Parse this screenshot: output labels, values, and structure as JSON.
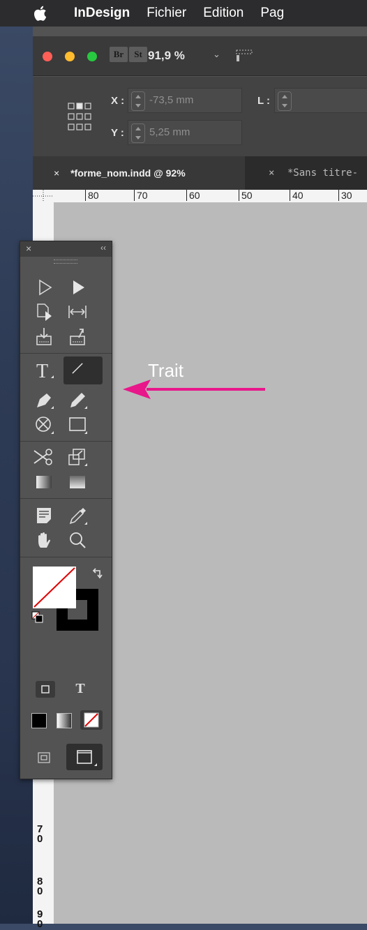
{
  "menubar": {
    "app_name": "InDesign",
    "items": [
      "Fichier",
      "Edition",
      "Pag"
    ]
  },
  "window": {
    "traffic_lights": {
      "close": "#ff5f57",
      "minimize": "#febc2e",
      "zoom": "#28c840"
    },
    "bridge_button": "Br",
    "stock_button": "St",
    "zoom_level": "91,9 %"
  },
  "control_panel": {
    "x_label": "X :",
    "x_value": "-73,5 mm",
    "y_label": "Y :",
    "y_value": "5,25 mm",
    "l_label": "L :"
  },
  "tabs": [
    {
      "close": "×",
      "label": "*forme_nom.indd @ 92%"
    },
    {
      "close": "×",
      "label": "*Sans titre-"
    }
  ],
  "ruler": {
    "horizontal_labels": [
      "80",
      "70",
      "60",
      "50",
      "40",
      "30"
    ],
    "vertical_labels": [
      "7\n0",
      "8\n0",
      "9\n0"
    ]
  },
  "tools_panel": {
    "close_label": "×",
    "collapse_label": "‹‹",
    "selected_tool": "line-tool",
    "tools": [
      "selection-tool-icon",
      "direct-selection-tool-icon",
      "page-tool-icon",
      "gap-tool-icon",
      "content-collector-icon",
      "content-placer-icon",
      "type-tool-icon",
      "line-tool-icon",
      "pen-tool-icon",
      "pencil-tool-icon",
      "rectangle-frame-tool-icon",
      "rectangle-tool-icon",
      "scissors-tool-icon",
      "free-transform-tool-icon",
      "gradient-swatch-tool-icon",
      "gradient-feather-tool-icon",
      "note-tool-icon",
      "eyedropper-tool-icon",
      "hand-tool-icon",
      "zoom-tool-icon"
    ],
    "text_toggle_label": "T"
  },
  "annotation": {
    "label": "Trait",
    "arrow_color": "#e8178a"
  }
}
